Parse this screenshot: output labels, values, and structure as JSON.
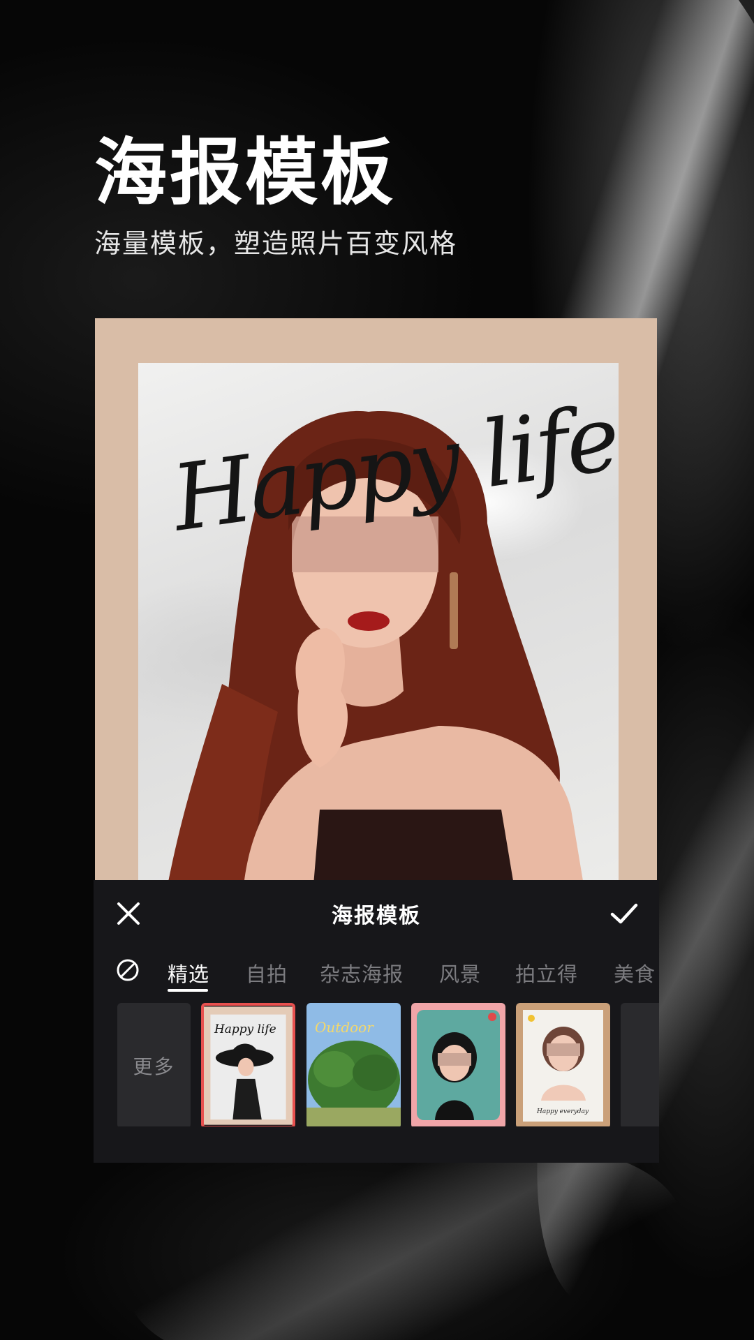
{
  "promo": {
    "headline": "海报模板",
    "subtitle": "海量模板，塑造照片百变风格"
  },
  "poster": {
    "script_text": "Happy life"
  },
  "panel": {
    "title": "海报模板",
    "close_icon": "close-icon",
    "confirm_icon": "check-icon",
    "none_icon": "no-filter-icon",
    "tabs": [
      {
        "label": "精选",
        "active": true
      },
      {
        "label": "自拍",
        "active": false
      },
      {
        "label": "杂志海报",
        "active": false
      },
      {
        "label": "风景",
        "active": false
      },
      {
        "label": "拍立得",
        "active": false
      },
      {
        "label": "美食",
        "active": false
      }
    ],
    "more_label": "更多",
    "templates": [
      {
        "script": "Happy life",
        "selected": true
      },
      {
        "script": "Outdoor",
        "selected": false
      },
      {
        "script": "",
        "selected": false
      },
      {
        "script": "Happy everyday",
        "selected": false
      }
    ]
  },
  "colors": {
    "selected_border": "#e8514f",
    "panel_bg": "#17171a",
    "poster_bg": "#d9bda7"
  }
}
